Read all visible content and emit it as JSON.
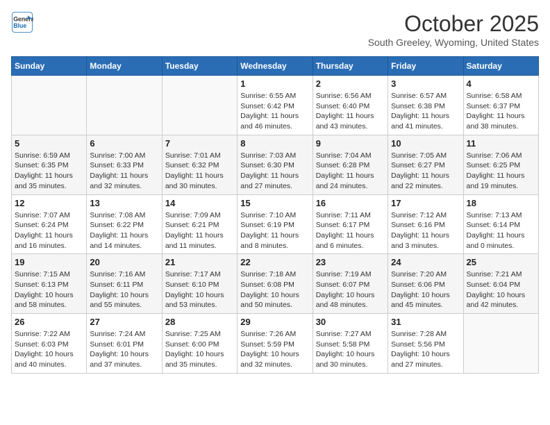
{
  "logo": {
    "line1": "General",
    "line2": "Blue"
  },
  "title": "October 2025",
  "subtitle": "South Greeley, Wyoming, United States",
  "days_of_week": [
    "Sunday",
    "Monday",
    "Tuesday",
    "Wednesday",
    "Thursday",
    "Friday",
    "Saturday"
  ],
  "weeks": [
    [
      {
        "num": "",
        "info": ""
      },
      {
        "num": "",
        "info": ""
      },
      {
        "num": "",
        "info": ""
      },
      {
        "num": "1",
        "info": "Sunrise: 6:55 AM\nSunset: 6:42 PM\nDaylight: 11 hours and 46 minutes."
      },
      {
        "num": "2",
        "info": "Sunrise: 6:56 AM\nSunset: 6:40 PM\nDaylight: 11 hours and 43 minutes."
      },
      {
        "num": "3",
        "info": "Sunrise: 6:57 AM\nSunset: 6:38 PM\nDaylight: 11 hours and 41 minutes."
      },
      {
        "num": "4",
        "info": "Sunrise: 6:58 AM\nSunset: 6:37 PM\nDaylight: 11 hours and 38 minutes."
      }
    ],
    [
      {
        "num": "5",
        "info": "Sunrise: 6:59 AM\nSunset: 6:35 PM\nDaylight: 11 hours and 35 minutes."
      },
      {
        "num": "6",
        "info": "Sunrise: 7:00 AM\nSunset: 6:33 PM\nDaylight: 11 hours and 32 minutes."
      },
      {
        "num": "7",
        "info": "Sunrise: 7:01 AM\nSunset: 6:32 PM\nDaylight: 11 hours and 30 minutes."
      },
      {
        "num": "8",
        "info": "Sunrise: 7:03 AM\nSunset: 6:30 PM\nDaylight: 11 hours and 27 minutes."
      },
      {
        "num": "9",
        "info": "Sunrise: 7:04 AM\nSunset: 6:28 PM\nDaylight: 11 hours and 24 minutes."
      },
      {
        "num": "10",
        "info": "Sunrise: 7:05 AM\nSunset: 6:27 PM\nDaylight: 11 hours and 22 minutes."
      },
      {
        "num": "11",
        "info": "Sunrise: 7:06 AM\nSunset: 6:25 PM\nDaylight: 11 hours and 19 minutes."
      }
    ],
    [
      {
        "num": "12",
        "info": "Sunrise: 7:07 AM\nSunset: 6:24 PM\nDaylight: 11 hours and 16 minutes."
      },
      {
        "num": "13",
        "info": "Sunrise: 7:08 AM\nSunset: 6:22 PM\nDaylight: 11 hours and 14 minutes."
      },
      {
        "num": "14",
        "info": "Sunrise: 7:09 AM\nSunset: 6:21 PM\nDaylight: 11 hours and 11 minutes."
      },
      {
        "num": "15",
        "info": "Sunrise: 7:10 AM\nSunset: 6:19 PM\nDaylight: 11 hours and 8 minutes."
      },
      {
        "num": "16",
        "info": "Sunrise: 7:11 AM\nSunset: 6:17 PM\nDaylight: 11 hours and 6 minutes."
      },
      {
        "num": "17",
        "info": "Sunrise: 7:12 AM\nSunset: 6:16 PM\nDaylight: 11 hours and 3 minutes."
      },
      {
        "num": "18",
        "info": "Sunrise: 7:13 AM\nSunset: 6:14 PM\nDaylight: 11 hours and 0 minutes."
      }
    ],
    [
      {
        "num": "19",
        "info": "Sunrise: 7:15 AM\nSunset: 6:13 PM\nDaylight: 10 hours and 58 minutes."
      },
      {
        "num": "20",
        "info": "Sunrise: 7:16 AM\nSunset: 6:11 PM\nDaylight: 10 hours and 55 minutes."
      },
      {
        "num": "21",
        "info": "Sunrise: 7:17 AM\nSunset: 6:10 PM\nDaylight: 10 hours and 53 minutes."
      },
      {
        "num": "22",
        "info": "Sunrise: 7:18 AM\nSunset: 6:08 PM\nDaylight: 10 hours and 50 minutes."
      },
      {
        "num": "23",
        "info": "Sunrise: 7:19 AM\nSunset: 6:07 PM\nDaylight: 10 hours and 48 minutes."
      },
      {
        "num": "24",
        "info": "Sunrise: 7:20 AM\nSunset: 6:06 PM\nDaylight: 10 hours and 45 minutes."
      },
      {
        "num": "25",
        "info": "Sunrise: 7:21 AM\nSunset: 6:04 PM\nDaylight: 10 hours and 42 minutes."
      }
    ],
    [
      {
        "num": "26",
        "info": "Sunrise: 7:22 AM\nSunset: 6:03 PM\nDaylight: 10 hours and 40 minutes."
      },
      {
        "num": "27",
        "info": "Sunrise: 7:24 AM\nSunset: 6:01 PM\nDaylight: 10 hours and 37 minutes."
      },
      {
        "num": "28",
        "info": "Sunrise: 7:25 AM\nSunset: 6:00 PM\nDaylight: 10 hours and 35 minutes."
      },
      {
        "num": "29",
        "info": "Sunrise: 7:26 AM\nSunset: 5:59 PM\nDaylight: 10 hours and 32 minutes."
      },
      {
        "num": "30",
        "info": "Sunrise: 7:27 AM\nSunset: 5:58 PM\nDaylight: 10 hours and 30 minutes."
      },
      {
        "num": "31",
        "info": "Sunrise: 7:28 AM\nSunset: 5:56 PM\nDaylight: 10 hours and 27 minutes."
      },
      {
        "num": "",
        "info": ""
      }
    ]
  ]
}
